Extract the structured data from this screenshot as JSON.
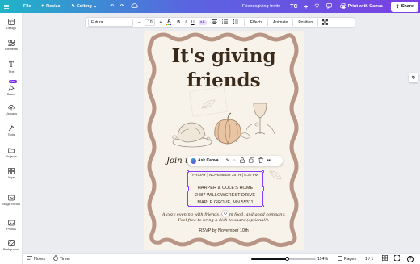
{
  "topbar": {
    "file_label": "File",
    "resize_label": "Resize",
    "editing_label": "Editing",
    "doc_title": "Friendsgiving Invite",
    "avatar_initials": "TC",
    "print_label": "Print with Canva",
    "share_label": "Share"
  },
  "sidebar": {
    "items": [
      {
        "label": "Design",
        "icon": "layout-icon"
      },
      {
        "label": "Elements",
        "icon": "shapes-icon"
      },
      {
        "label": "Text",
        "icon": "text-icon"
      },
      {
        "label": "Brand",
        "icon": "brand-icon",
        "badge": "New"
      },
      {
        "label": "Uploads",
        "icon": "upload-icon"
      },
      {
        "label": "Tools",
        "icon": "tools-icon"
      },
      {
        "label": "Projects",
        "icon": "folder-icon"
      },
      {
        "label": "Apps",
        "icon": "apps-icon"
      },
      {
        "label": "Magic Media",
        "icon": "magic-media-icon"
      },
      {
        "label": "Photos",
        "icon": "photo-icon"
      },
      {
        "label": "Background",
        "icon": "background-icon"
      }
    ]
  },
  "toolbar": {
    "font_family": "Futura",
    "font_size": "10",
    "minus": "−",
    "plus": "+",
    "effects_label": "Effects",
    "animate_label": "Animate",
    "position_label": "Position"
  },
  "invite": {
    "title_line1": "It's giving",
    "title_line2": "friends",
    "script_left": "Join u",
    "script_right": "inner",
    "date_line": "FRIDAY | NOVEMBER 25TH | 6:30 PM",
    "home_line": "HARPER & COLE'S HOME",
    "street_line": "2487 WILLOWCREST DRIVE",
    "city_line": "MAPLE GROVE, MN 55311",
    "desc_line1": "A cozy evening with friends, warm food, and good company.",
    "desc_line2": "Feel free to bring a dish to share (optional!).",
    "rsvp_line": "RSVP by November 10th"
  },
  "canva_pill": {
    "ask_label": "Ask Canva"
  },
  "bottombar": {
    "notes_label": "Notes",
    "timer_label": "Timer",
    "zoom": "114%",
    "pages_label": "Pages",
    "page_count": "1 / 1"
  },
  "colors": {
    "accent": "#8b3dff",
    "frame": "#b89585",
    "title": "#3a2a1a"
  }
}
